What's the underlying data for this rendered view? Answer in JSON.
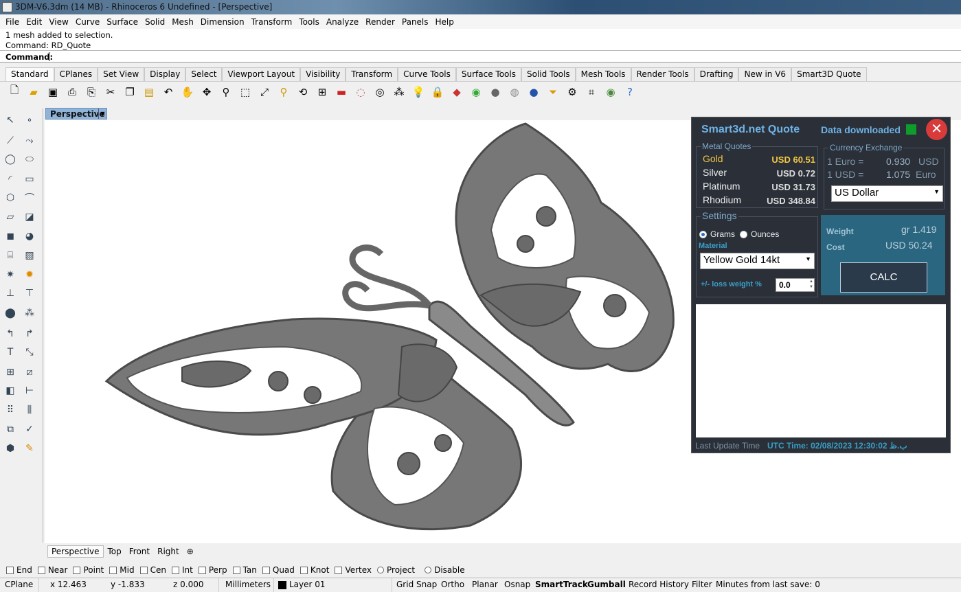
{
  "window": {
    "title": "3DM-V6.3dm (14 MB) - Rhinoceros 6 Undefined - [Perspective]"
  },
  "menu": [
    "File",
    "Edit",
    "View",
    "Curve",
    "Surface",
    "Solid",
    "Mesh",
    "Dimension",
    "Transform",
    "Tools",
    "Analyze",
    "Render",
    "Panels",
    "Help"
  ],
  "command": {
    "history": [
      "1 mesh added to selection.",
      "Command: RD_Quote"
    ],
    "prompt": "Command:"
  },
  "toolbar_tabs": [
    "Standard",
    "CPlanes",
    "Set View",
    "Display",
    "Select",
    "Viewport Layout",
    "Visibility",
    "Transform",
    "Curve Tools",
    "Surface Tools",
    "Solid Tools",
    "Mesh Tools",
    "Render Tools",
    "Drafting",
    "New in V6",
    "Smart3D Quote"
  ],
  "toolbar_icons": [
    "new-icon",
    "open-icon",
    "save-icon",
    "print-icon",
    "import-icon",
    "cut-icon",
    "copy-icon",
    "paste-icon",
    "undo-icon",
    "pan-icon",
    "rotate-icon",
    "zoom-icon",
    "zoom-window-icon",
    "zoom-extents-icon",
    "zoom-selected-icon",
    "rotate-view-icon",
    "viewport-layout-icon",
    "car-icon",
    "hide-icon",
    "show-icon",
    "points-icon",
    "light-icon",
    "lock-icon",
    "layer-icon",
    "color-icon",
    "sphere-icon",
    "render-sphere-icon",
    "ball-icon",
    "filter-icon",
    "options-icon",
    "snap-icon",
    "globe-icon",
    "help-icon"
  ],
  "viewport": {
    "name": "Perspective"
  },
  "view_tabs": [
    "Perspective",
    "Top",
    "Front",
    "Right"
  ],
  "osnaps": [
    {
      "label": "End",
      "type": "box"
    },
    {
      "label": "Near",
      "type": "box"
    },
    {
      "label": "Point",
      "type": "box"
    },
    {
      "label": "Mid",
      "type": "box"
    },
    {
      "label": "Cen",
      "type": "box"
    },
    {
      "label": "Int",
      "type": "box"
    },
    {
      "label": "Perp",
      "type": "box"
    },
    {
      "label": "Tan",
      "type": "box"
    },
    {
      "label": "Quad",
      "type": "box"
    },
    {
      "label": "Knot",
      "type": "box"
    },
    {
      "label": "Vertex",
      "type": "box"
    },
    {
      "label": "Project",
      "type": "radio"
    },
    {
      "label": "Disable",
      "type": "radio"
    }
  ],
  "status": {
    "cplane": "CPlane",
    "x": "x 12.463",
    "y": "y -1.833",
    "z": "z 0.000",
    "units": "Millimeters",
    "layer": "Layer 01",
    "grid_snap": "Grid Snap",
    "ortho": "Ortho",
    "planar": "Planar",
    "osnap": "Osnap",
    "smarttrack": "SmartTrack",
    "gumball": "Gumball",
    "record_history": "Record History",
    "filter": "Filter",
    "minutes": "Minutes from last save: 0"
  },
  "quote": {
    "title": "Smart3d.net Quote",
    "download_status": "Data downloaded",
    "metal_title": "Metal Quotes",
    "metals": [
      {
        "name": "Gold",
        "price": "USD 60.51"
      },
      {
        "name": "Silver",
        "price": "USD 0.72"
      },
      {
        "name": "Platinum",
        "price": "USD 31.73"
      },
      {
        "name": "Rhodium",
        "price": "USD 348.84"
      }
    ],
    "currency_title": "Currency Exchange",
    "rates": [
      {
        "label": "1 Euro =",
        "value": "0.930",
        "unit": "USD"
      },
      {
        "label": "1 USD =",
        "value": "1.075",
        "unit": "Euro"
      }
    ],
    "currency": "US Dollar",
    "settings_title": "Settings",
    "unit_grams": "Grams",
    "unit_ounces": "Ounces",
    "material_label": "Material",
    "material": "Yellow Gold 14kt",
    "loss_label": "+/- loss weight %",
    "loss_value": "0.0",
    "weight_label": "Weight",
    "weight_value": "gr 1.419",
    "cost_label": "Cost",
    "cost_value": "USD  50.24",
    "calc": "CALC",
    "last_update_label": "Last Update Time",
    "utc": "UTC Time: 02/08/2023 12:30:02 ب.ظ"
  },
  "colors": {
    "accent": "#6fb3e6",
    "panel_bg": "#2a2f38",
    "result_bg": "#2b6680",
    "close": "#d93b3b",
    "indicator": "#109c2c",
    "gold": "#f2c744"
  }
}
